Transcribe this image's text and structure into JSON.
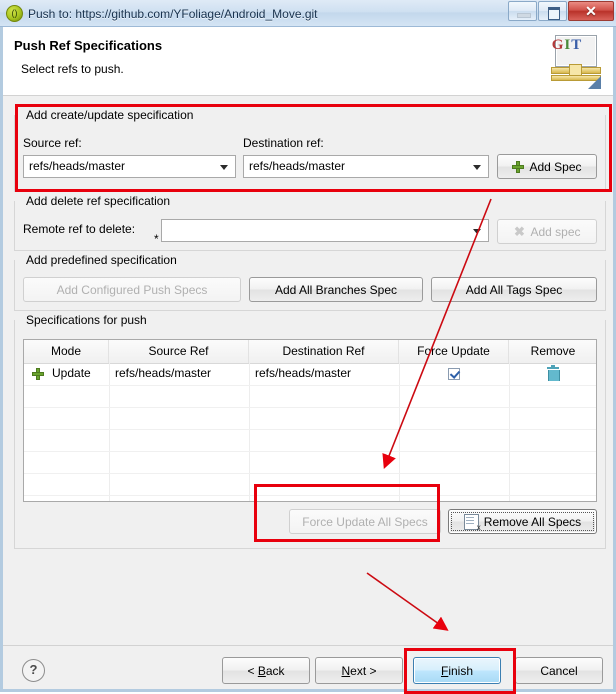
{
  "titlebar": {
    "title": "Push to: https://github.com/YFoliage/Android_Move.git",
    "app_icon": "git-push-icon",
    "minimize_label": "",
    "maximize_label": "",
    "close_label": "✕"
  },
  "header": {
    "title": "Push Ref Specifications",
    "subtitle": "Select refs to push.",
    "logo_letters": [
      "G",
      "I",
      "T"
    ],
    "logo_colors": [
      "#b33a3a",
      "#4a8a3a",
      "#3a5fa8"
    ]
  },
  "create_update_group": {
    "legend": "Add create/update specification",
    "source_label": "Source ref:",
    "source_value": "refs/heads/master",
    "destination_label": "Destination ref:",
    "destination_value": "refs/heads/master",
    "add_spec_label": "Add Spec",
    "add_spec_icon": "green-plus-icon"
  },
  "delete_group": {
    "legend": "Add delete ref specification",
    "remote_ref_label": "Remote ref to delete:",
    "remote_ref_value": "",
    "remote_ref_required_marker": "*",
    "add_spec_label": "Add spec",
    "add_spec_icon": "gray-x-icon"
  },
  "predefined_group": {
    "legend": "Add predefined specification",
    "configured_label": "Add Configured Push Specs",
    "all_branches_label": "Add All Branches Spec",
    "all_tags_label": "Add All Tags Spec"
  },
  "specs_group": {
    "legend": "Specifications for push",
    "columns": [
      "Mode",
      "Source Ref",
      "Destination Ref",
      "Force Update",
      "Remove"
    ],
    "rows": [
      {
        "mode_icon": "green-plus-icon",
        "mode": "Update",
        "source_ref": "refs/heads/master",
        "destination_ref": "refs/heads/master",
        "force_update": true,
        "remove_icon": "trash-icon"
      }
    ],
    "force_update_all_label": "Force Update All Specs",
    "remove_all_label": "Remove All Specs",
    "remove_all_icon": "remove-all-icon"
  },
  "footer": {
    "help_label": "?",
    "back_label": "< Back",
    "back_mnemonic": "B",
    "next_label": "Next >",
    "next_mnemonic": "N",
    "finish_label": "Finish",
    "finish_mnemonic": "F",
    "cancel_label": "Cancel"
  },
  "annotations": {
    "highlight_color": "#e8000d",
    "boxes": [
      {
        "name": "create-update-group-highlight"
      },
      {
        "name": "force-update-all-highlight"
      },
      {
        "name": "finish-button-highlight"
      }
    ],
    "arrows": [
      {
        "name": "arrow-to-table"
      },
      {
        "name": "arrow-to-finish"
      }
    ]
  }
}
